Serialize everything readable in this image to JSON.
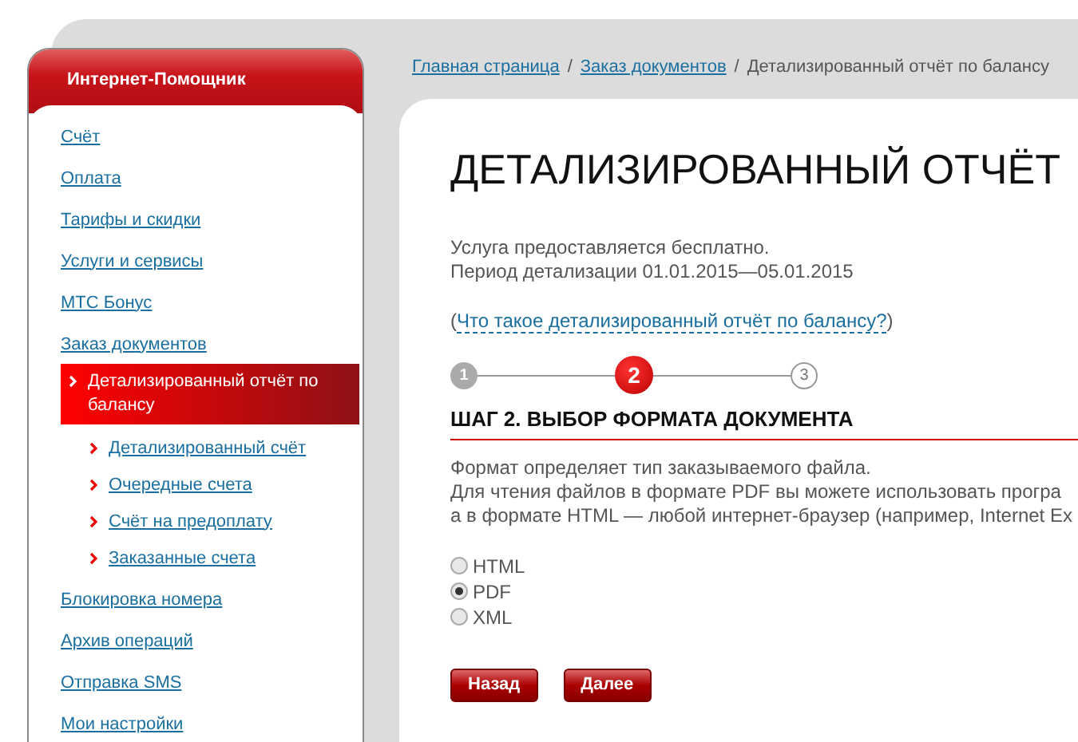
{
  "sidebar": {
    "title": "Интернет-Помощник",
    "items": [
      {
        "label": "Счёт",
        "selected": false
      },
      {
        "label": "Оплата",
        "selected": false
      },
      {
        "label": "Тарифы и скидки",
        "selected": false
      },
      {
        "label": "Услуги и сервисы",
        "selected": false
      },
      {
        "label": "МТС Бонус",
        "selected": false
      },
      {
        "label": "Заказ документов",
        "selected": false,
        "children": [
          {
            "label": "Детализированный отчёт по балансу",
            "selected": true
          },
          {
            "label": "Детализированный счёт",
            "selected": false
          },
          {
            "label": "Очередные счета",
            "selected": false
          },
          {
            "label": "Счёт на предоплату",
            "selected": false
          },
          {
            "label": "Заказанные счета",
            "selected": false
          }
        ]
      },
      {
        "label": "Блокировка номера",
        "selected": false
      },
      {
        "label": "Архив операций",
        "selected": false
      },
      {
        "label": "Отправка SMS",
        "selected": false
      },
      {
        "label": "Мои настройки",
        "selected": false
      }
    ]
  },
  "breadcrumb": {
    "links": [
      "Главная страница",
      "Заказ документов"
    ],
    "separators": [
      "/",
      "/"
    ],
    "current": "Детализированный отчёт по балансу"
  },
  "title": "ДЕТАЛИЗИРОВАННЫЙ ОТЧЁТ",
  "info_lines": [
    "Услуга предоставляется бесплатно.",
    "Период детализации 01.01.2015—05.01.2015"
  ],
  "help_link": {
    "prefix": "(",
    "label": "Что такое детализированный отчёт по балансу?",
    "suffix": ")"
  },
  "steps": [
    {
      "number": "1",
      "completed": true,
      "selected": false
    },
    {
      "number": "2",
      "completed": false,
      "selected": true
    },
    {
      "number": "3",
      "completed": false,
      "selected": false
    }
  ],
  "section_heading": "ШАГ 2. ВЫБОР ФОРМАТА ДОКУМЕНТА",
  "description_lines": [
    "Формат определяет тип заказываемого файла.",
    "Для чтения файлов в формате PDF вы можете использовать програ",
    "а в формате HTML — любой интернет-браузер (например, Internet Ex"
  ],
  "formats": [
    {
      "label": "HTML",
      "selected": false
    },
    {
      "label": "PDF",
      "selected": true
    },
    {
      "label": "XML",
      "selected": false
    }
  ],
  "buttons": [
    "Назад",
    "Далее"
  ]
}
